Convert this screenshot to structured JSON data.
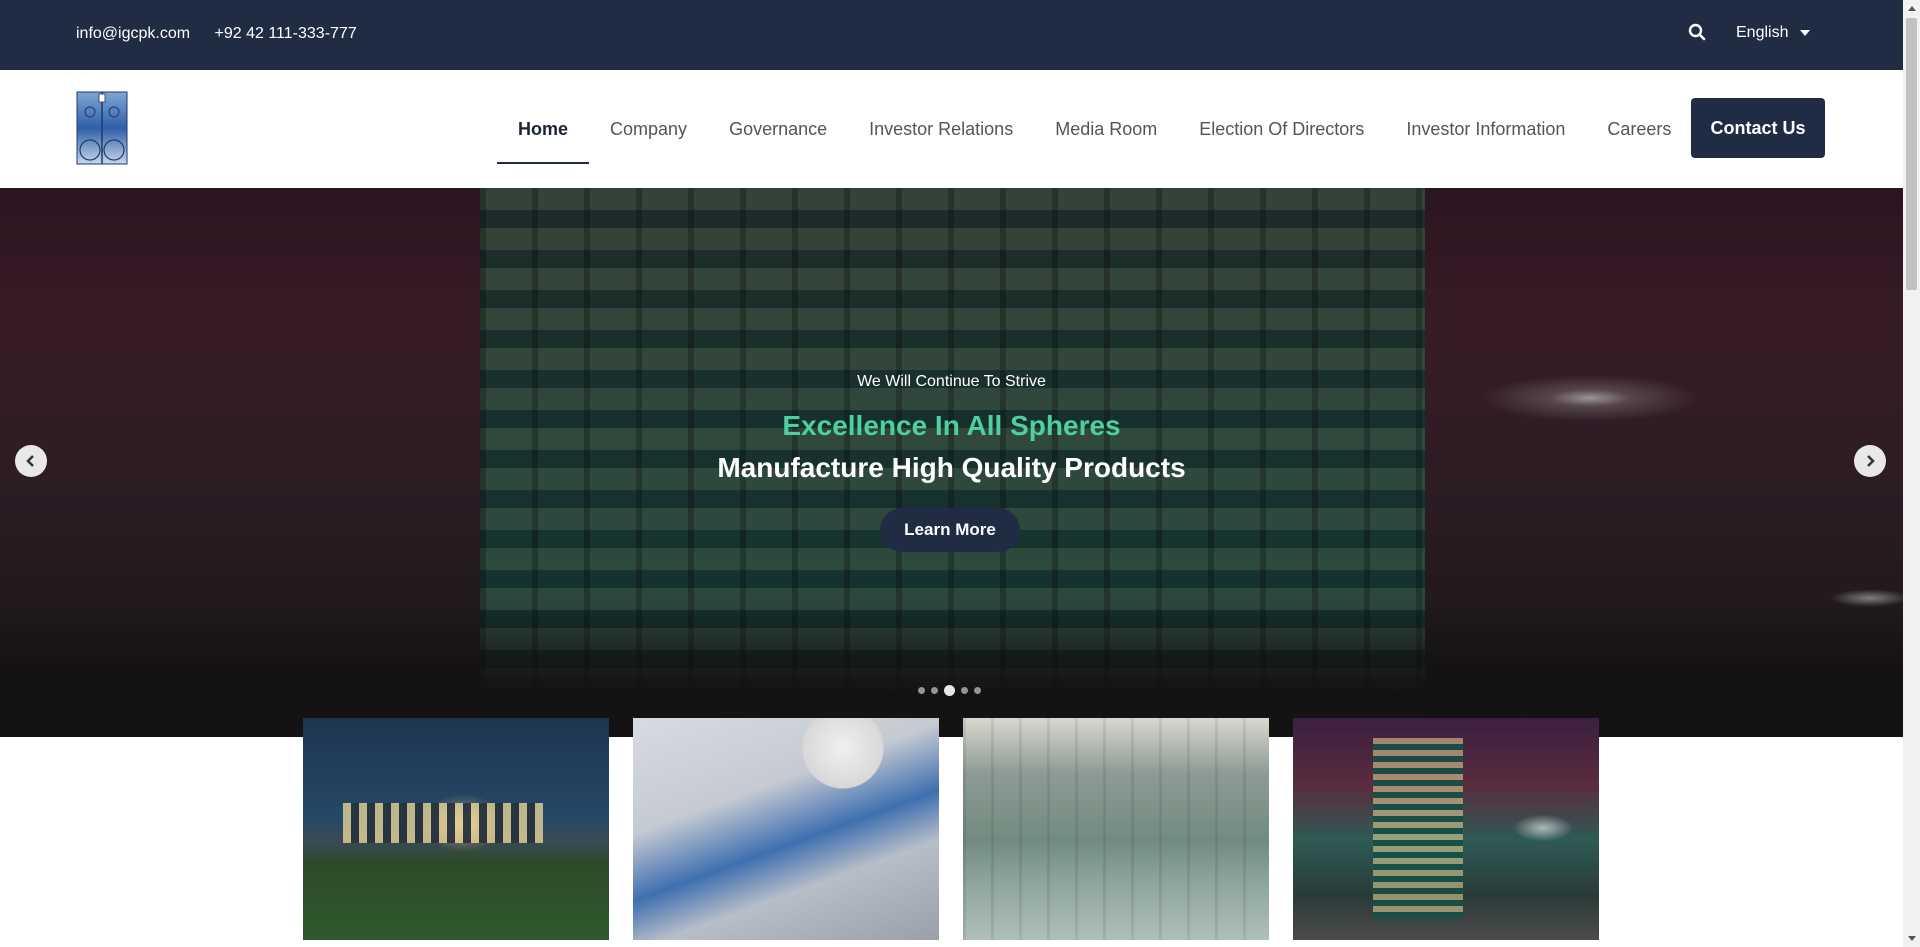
{
  "topbar": {
    "email": "info@igcpk.com",
    "phone": "+92 42 111-333-777",
    "language": "English"
  },
  "nav": {
    "items": [
      {
        "label": "Home",
        "active": true
      },
      {
        "label": "Company"
      },
      {
        "label": "Governance"
      },
      {
        "label": "Investor Relations"
      },
      {
        "label": "Media Room"
      },
      {
        "label": "Election Of Directors"
      },
      {
        "label": "Investor Information"
      },
      {
        "label": "Careers"
      }
    ],
    "cta": "Contact Us"
  },
  "hero": {
    "subtitle": "We Will Continue To Strive",
    "title_accent": "Excellence In All Spheres",
    "title_main": "Manufacture High Quality Products",
    "button": "Learn More",
    "slides": 5,
    "active_slide": 3
  },
  "colors": {
    "primary": "#202c43",
    "accent": "#4ecfa0"
  },
  "icons": {
    "search": "search-icon",
    "language_caret": "caret-down-icon",
    "prev": "chevron-left-icon",
    "next": "chevron-right-icon"
  }
}
